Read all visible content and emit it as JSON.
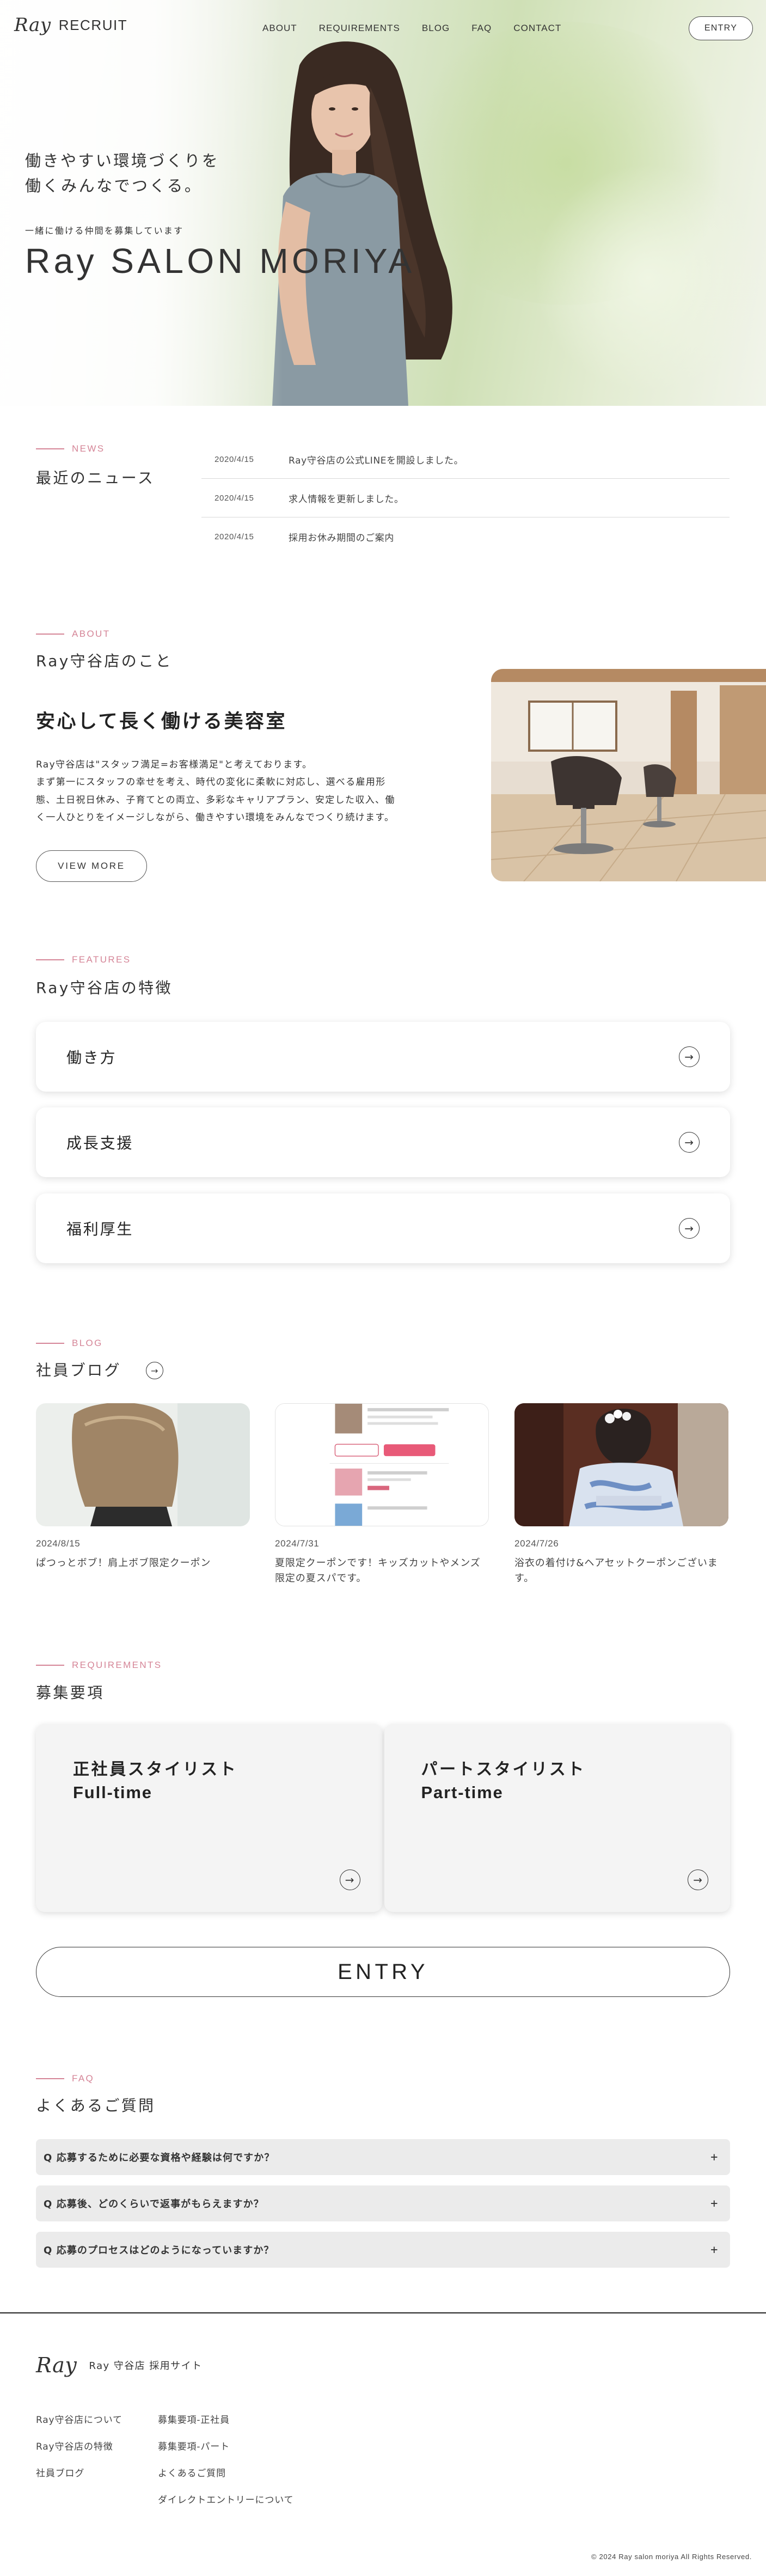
{
  "header": {
    "logo_mark": "Ray",
    "logo_text": "RECRUIT",
    "nav": [
      "ABOUT",
      "REQUIREMENTS",
      "BLOG",
      "FAQ",
      "CONTACT"
    ],
    "entry_label": "ENTRY"
  },
  "hero": {
    "catch_line1": "働きやすい環境づくりを",
    "catch_line2": "働くみんなでつくる。",
    "subtitle": "一緒に働ける仲間を募集しています",
    "title": "Ray SALON MORIYA"
  },
  "news": {
    "label": "NEWS",
    "title": "最近のニュース",
    "items": [
      {
        "date": "2020/4/15",
        "text": "Ray守谷店の公式LINEを開設しました。"
      },
      {
        "date": "2020/4/15",
        "text": "求人情報を更新しました。"
      },
      {
        "date": "2020/4/15",
        "text": "採用お休み期間のご案内"
      }
    ]
  },
  "about": {
    "label": "ABOUT",
    "title": "Ray守谷店のこと",
    "heading": "安心して長く働ける美容室",
    "body_line1": "Ray守谷店は\"スタッフ満足=お客様満足\"と考えております。",
    "body_line2": "まず第一にスタッフの幸せを考え、時代の変化に柔軟に対応し、選べる雇用形",
    "body_line3": "態、土日祝日休み、子育てとの両立、多彩なキャリアプラン、安定した収入、働",
    "body_line4": "く一人ひとりをイメージしながら、働きやすい環境をみんなでつくり続けます。",
    "button": "VIEW MORE"
  },
  "features": {
    "label": "FEATURES",
    "title": "Ray守谷店の特徴",
    "items": [
      "働き方",
      "成長支援",
      "福利厚生"
    ]
  },
  "blog": {
    "label": "BLOG",
    "title": "社員ブログ",
    "posts": [
      {
        "date": "2024/8/15",
        "text": "ぱつっとボブ！肩上ボブ限定クーポン"
      },
      {
        "date": "2024/7/31",
        "text": "夏限定クーポンです！キッズカットやメンズ限定の夏スパです。"
      },
      {
        "date": "2024/7/26",
        "text": "浴衣の着付け&ヘアセットクーポンございます。"
      }
    ]
  },
  "requirements": {
    "label": "REQUIREMENTS",
    "title": "募集要項",
    "cards": [
      {
        "jp": "正社員スタイリスト",
        "en": "Full-time"
      },
      {
        "jp": "パートスタイリスト",
        "en": "Part-time"
      }
    ],
    "entry_button": "ENTRY"
  },
  "faq": {
    "label": "FAQ",
    "title": "よくあるご質問",
    "items": [
      "Q 応募するために必要な資格や経験は何ですか？",
      "Q 応募後、どのくらいで返事がもらえますか？",
      "Q 応募のプロセスはどのようになっていますか？"
    ]
  },
  "footer": {
    "logo_mark": "Ray",
    "site_name": "Ray 守谷店 採用サイト",
    "col1": [
      "Ray守谷店について",
      "Ray守谷店の特徴",
      "社員ブログ"
    ],
    "col2": [
      "募集要項-正社員",
      "募集要項-パート",
      "よくあるご質問",
      "ダイレクトエントリーについて"
    ],
    "copyright": "© 2024 Ray salon moriya All Rights Reserved."
  },
  "colors": {
    "accent_pink": "#d58597",
    "text": "#222222",
    "faq_bg": "#ebebeb",
    "req_card_bg": "#f4f4f4"
  },
  "icons": [
    "circle-arrow-right-icon",
    "plus-icon"
  ]
}
